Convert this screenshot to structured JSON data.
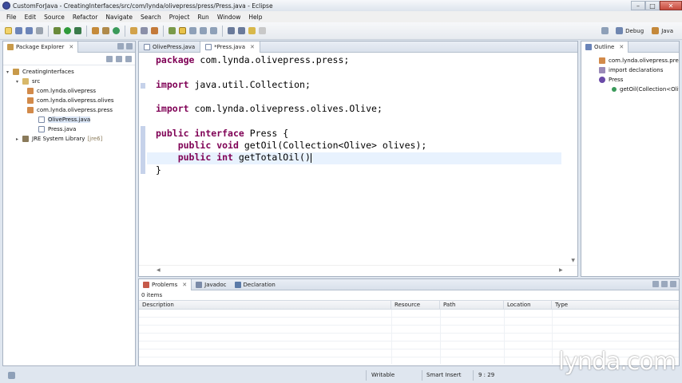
{
  "window": {
    "title": "CustomForJava - CreatingInterfaces/src/com/lynda/olivepress/press/Press.java - Eclipse",
    "buttons": {
      "minimize": "–",
      "maximize": "□",
      "close": "✕"
    }
  },
  "menu": [
    "File",
    "Edit",
    "Source",
    "Refactor",
    "Navigate",
    "Search",
    "Project",
    "Run",
    "Window",
    "Help"
  ],
  "perspectives": {
    "debug": "Debug",
    "java": "Java"
  },
  "package_explorer": {
    "title": "Package Explorer",
    "tree": [
      {
        "label": "CreatingInterfaces",
        "depth": 0,
        "icon": "project-icon"
      },
      {
        "label": "src",
        "depth": 1,
        "icon": "source-folder-icon"
      },
      {
        "label": "com.lynda.olivepress",
        "depth": 2,
        "icon": "package-icon"
      },
      {
        "label": "com.lynda.olivepress.olives",
        "depth": 2,
        "icon": "package-icon"
      },
      {
        "label": "com.lynda.olivepress.press",
        "depth": 2,
        "icon": "package-icon"
      },
      {
        "label": "OlivePress.java",
        "depth": 3,
        "icon": "java-file-icon"
      },
      {
        "label": "Press.java",
        "depth": 3,
        "icon": "java-file-icon"
      },
      {
        "label": "JRE System Library",
        "suffix": "[jre6]",
        "depth": 1,
        "icon": "library-icon"
      }
    ]
  },
  "editor": {
    "tabs": [
      {
        "label": "OlivePress.java",
        "active": false
      },
      {
        "label": "*Press.java",
        "active": true
      }
    ],
    "code": [
      [
        {
          "t": "package",
          "k": true
        },
        {
          "t": " com.lynda.olivepress.press;"
        }
      ],
      [],
      [
        {
          "t": "import",
          "k": true
        },
        {
          "t": " java.util.Collection;"
        }
      ],
      [],
      [
        {
          "t": "import",
          "k": true
        },
        {
          "t": " com.lynda.olivepress.olives.Olive;"
        }
      ],
      [],
      [
        {
          "t": "public",
          "k": true
        },
        {
          "t": " "
        },
        {
          "t": "interface",
          "k": true
        },
        {
          "t": " Press {"
        }
      ],
      [
        {
          "t": "    "
        },
        {
          "t": "public",
          "k": true
        },
        {
          "t": " "
        },
        {
          "t": "void",
          "k": true
        },
        {
          "t": " getOil(Collection<Olive> olives);"
        }
      ],
      [
        {
          "t": "    "
        },
        {
          "t": "public",
          "k": true
        },
        {
          "t": " "
        },
        {
          "t": "int",
          "k": true
        },
        {
          "t": " getTotalOil()"
        }
      ],
      [
        {
          "t": "}"
        }
      ]
    ]
  },
  "outline": {
    "title": "Outline",
    "items": [
      {
        "label": "com.lynda.olivepress.press",
        "depth": 0,
        "icon": "package-icon"
      },
      {
        "label": "import declarations",
        "depth": 0,
        "icon": "imports-icon"
      },
      {
        "label": "Press",
        "depth": 0,
        "icon": "interface-icon"
      },
      {
        "label": "getOil(Collection<Olive>)",
        "depth": 1,
        "icon": "method-icon"
      }
    ]
  },
  "bottom_panel": {
    "tabs": [
      {
        "label": "Problems",
        "active": true
      },
      {
        "label": "Javadoc",
        "active": false
      },
      {
        "label": "Declaration",
        "active": false
      }
    ],
    "count": "0 items",
    "columns": [
      "Description",
      "Resource",
      "Path",
      "Location",
      "Type"
    ]
  },
  "status": {
    "writable": "Writable",
    "insert_mode": "Smart Insert",
    "position": "9 : 29"
  },
  "watermark": "lynda.com",
  "colors": {
    "keyword": "#7f0055",
    "current_line": "#e8f2fe",
    "change_bar": "#c6d2ea"
  }
}
